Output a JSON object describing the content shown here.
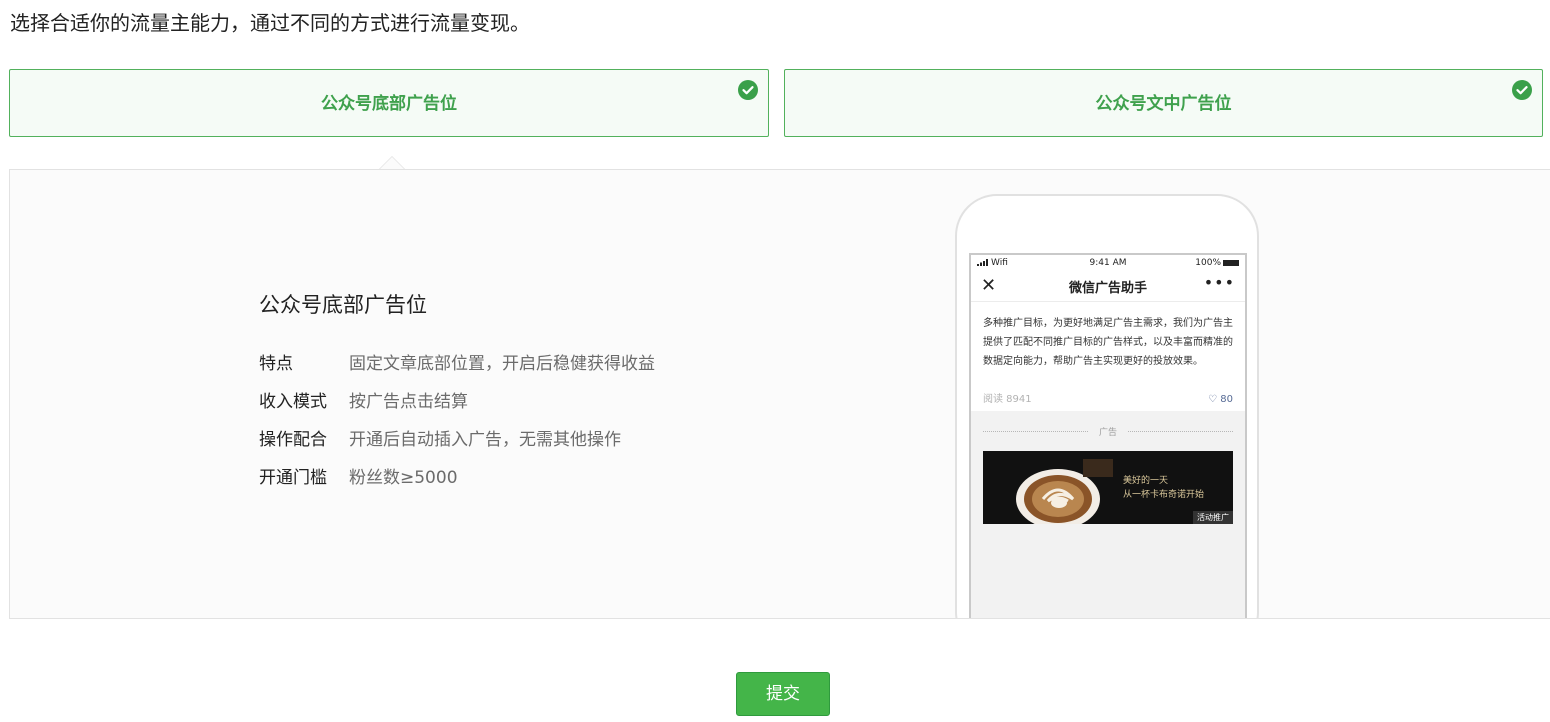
{
  "intro": "选择合适你的流量主能力，通过不同的方式进行流量变现。",
  "options": [
    {
      "label": "公众号底部广告位",
      "selected": true
    },
    {
      "label": "公众号文中广告位",
      "selected": true
    }
  ],
  "detail": {
    "title": "公众号底部广告位",
    "rows": [
      {
        "key": "特点",
        "value": "固定文章底部位置，开启后稳健获得收益"
      },
      {
        "key": "收入模式",
        "value": "按广告点击结算"
      },
      {
        "key": "操作配合",
        "value": "开通后自动插入广告，无需其他操作"
      },
      {
        "key": "开通门槛",
        "value": "粉丝数≥5000"
      }
    ]
  },
  "phone": {
    "status": {
      "left": "Wifi",
      "time": "9:41 AM",
      "battery": "100%"
    },
    "nav_title": "微信广告助手",
    "nav_close": "✕",
    "nav_more": "•••",
    "article_body": "多种推广目标，为更好地满足广告主需求，我们为广告主提供了匹配不同推广目标的广告样式，以及丰富而精准的数据定向能力，帮助广告主实现更好的投放效果。",
    "reads": "阅读 8941",
    "likes": "♡ 80",
    "ad_label": "广告",
    "ad_line1": "美好的一天",
    "ad_line2": "从一杯卡布奇诺开始",
    "ad_tag": "活动推广"
  },
  "submit_label": "提交",
  "colors": {
    "accent": "#44b549",
    "selected_border": "#52b15c",
    "selected_text": "#3fa14d"
  }
}
